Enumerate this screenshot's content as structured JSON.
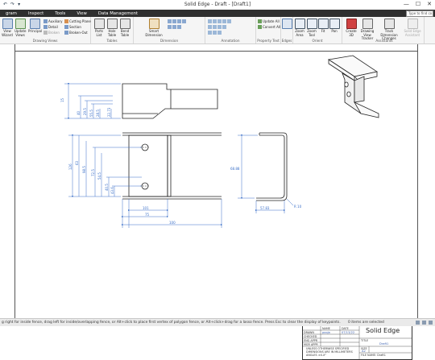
{
  "titlebar": {
    "title": "Solid Edge - Draft - [Draft1]",
    "minimize_icon": "minimize-icon",
    "maximize_icon": "maximize-icon",
    "close_icon": "close-icon"
  },
  "menu": {
    "items": [
      "gram",
      "Inspect",
      "Tools",
      "View",
      "Data Management"
    ]
  },
  "search": {
    "placeholder": "Type to find co"
  },
  "ribbon": {
    "drawing_views": {
      "label": "Drawing Views",
      "view_wizard": "View Wizard",
      "update_views": "Update Views",
      "principal": "Principal",
      "auxiliary": "Auxiliary",
      "detail": "Detail",
      "broken": "Broken",
      "cutting_plane": "Cutting Plane",
      "section": "Section",
      "broken_out": "Broken-Out"
    },
    "tables": {
      "label": "Tables",
      "parts_list": "Parts List",
      "hole_table": "Hole Table",
      "bend_table": "Bend Table"
    },
    "dimension": {
      "label": "Dimension",
      "smart_dimension": "Smart Dimension"
    },
    "annotation": {
      "label": "Annotation"
    },
    "property_text": {
      "label": "Property Text",
      "update_all": "Update All",
      "convert_all": "Convert All"
    },
    "edges": {
      "label": "Edges"
    },
    "orient": {
      "label": "Orient",
      "zoom_area": "Zoom Area",
      "zoom_tool": "Zoom Tool",
      "fit": "Fit",
      "pan": "Pan"
    },
    "assistants": {
      "label": "Assistants",
      "create_3d": "Create 3D",
      "drawing_view_tracker": "Drawing View Tracker",
      "track_dimension_changes": "Track Dimension Changes",
      "solid_edge_assistant": "Solid Edge Assistant"
    }
  },
  "drawing": {
    "front_dims": [
      "15",
      "40",
      "29.5",
      "55.5",
      "28.5"
    ],
    "front_extra": "22.73",
    "top_dims": [
      "126",
      "63",
      "98.5",
      "72.5",
      "54.5",
      "40.5",
      "43.6"
    ],
    "top_bottom_dims": [
      "101",
      "75",
      "100"
    ],
    "side_dims": [
      "68.88",
      "57.83",
      "R 10"
    ]
  },
  "title_block": {
    "logo": "Solid Edge",
    "hdr_name": "NAME",
    "hdr_date": "DATE",
    "drawn": "DRAWN",
    "checked": "CHECKED",
    "eng_appr": "ENG APPR",
    "mgr_appr": "MGR APPR",
    "drawn_name": "pooja",
    "drawn_date": "07/13/22",
    "note1": "UNLESS OTHERWISE SPECIFIED",
    "note2": "DIMENSIONS ARE IN MILLIMETERS",
    "note3": "ANGLES ±X.X°",
    "title_lbl": "TITLE",
    "title_val": "Draft1",
    "size_lbl": "SIZE",
    "size_val": "A2",
    "file_lbl": "FILE NAME: Draft1"
  },
  "status": {
    "prompt": "g right for inside fence, drag left for inside/overlapping fence, or Alt+click to place first vertex of polygon fence, or Alt+click+drag for a lasso fence. Press Esc to clear the display of keypoints.",
    "selection": "0 items are selected"
  }
}
